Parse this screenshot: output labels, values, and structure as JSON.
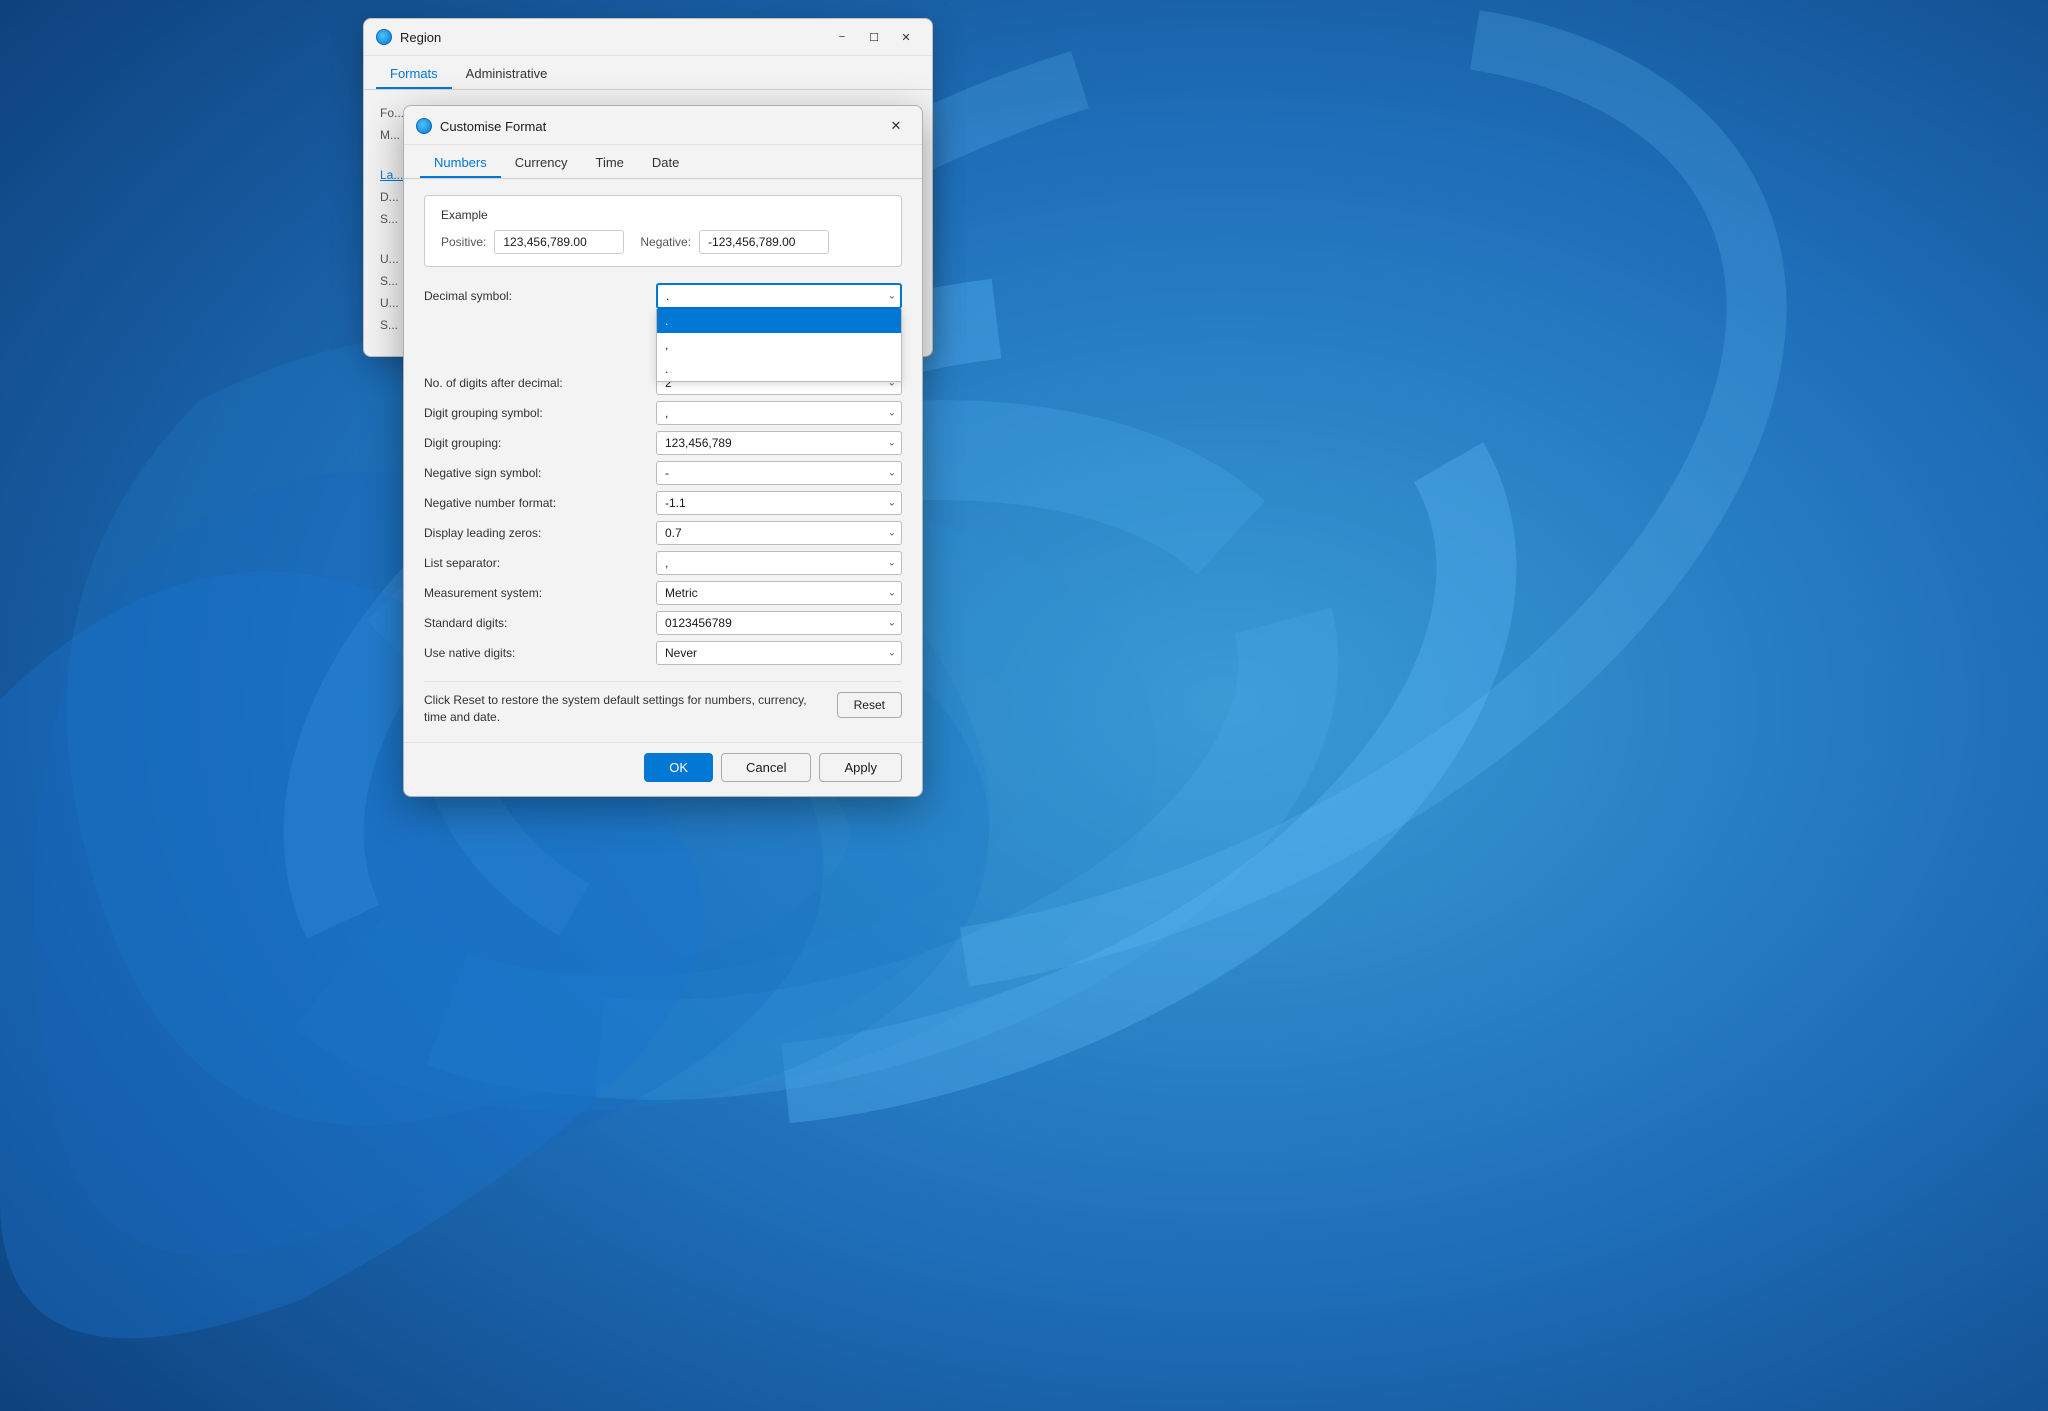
{
  "background": {
    "color_start": "#a8c8e8",
    "color_end": "#1a5fa8"
  },
  "region_window": {
    "title": "Region",
    "tabs": [
      {
        "label": "Formats",
        "active": true
      },
      {
        "label": "Administrative",
        "active": false
      }
    ],
    "fields": [
      "Fo...",
      "M..."
    ]
  },
  "customize_dialog": {
    "title": "Customise Format",
    "tabs": [
      {
        "label": "Numbers",
        "active": true
      },
      {
        "label": "Currency",
        "active": false
      },
      {
        "label": "Time",
        "active": false
      },
      {
        "label": "Date",
        "active": false
      }
    ],
    "example": {
      "section_label": "Example",
      "positive_label": "Positive:",
      "positive_value": "123,456,789.00",
      "negative_label": "Negative:",
      "negative_value": "-123,456,789.00"
    },
    "settings": [
      {
        "label": "Decimal symbol:",
        "value": ".",
        "key": "decimal_symbol",
        "is_open": true,
        "dropdown_items": [
          {
            "text": ".",
            "selected": true
          },
          {
            "text": ",",
            "selected": false
          },
          {
            "text": ".",
            "selected": false
          }
        ]
      },
      {
        "label": "No. of digits after decimal:",
        "value": "2",
        "key": "digits_after_decimal",
        "is_open": false
      },
      {
        "label": "Digit grouping symbol:",
        "value": ",",
        "key": "digit_grouping_symbol",
        "is_open": false
      },
      {
        "label": "Digit grouping:",
        "value": "123,456,789",
        "key": "digit_grouping",
        "is_open": false
      },
      {
        "label": "Negative sign symbol:",
        "value": "-",
        "key": "negative_sign",
        "is_open": false
      },
      {
        "label": "Negative number format:",
        "value": "-1.1",
        "key": "negative_format",
        "is_open": false
      },
      {
        "label": "Display leading zeros:",
        "value": "0.7",
        "key": "leading_zeros",
        "is_open": false
      },
      {
        "label": "List separator:",
        "value": ",",
        "key": "list_separator",
        "is_open": false
      },
      {
        "label": "Measurement system:",
        "value": "Metric",
        "key": "measurement",
        "is_open": false
      },
      {
        "label": "Standard digits:",
        "value": "0123456789",
        "key": "standard_digits",
        "is_open": false
      },
      {
        "label": "Use native digits:",
        "value": "Never",
        "key": "native_digits",
        "is_open": false
      }
    ],
    "reset_note": "Click Reset to restore the system default settings for numbers, currency, time and date.",
    "reset_button": "Reset",
    "buttons": {
      "ok": "OK",
      "cancel": "Cancel",
      "apply": "Apply"
    }
  }
}
